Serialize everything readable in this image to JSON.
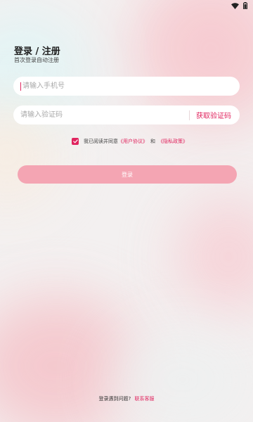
{
  "status_bar": {
    "icons": [
      "wifi-icon",
      "battery-icon"
    ]
  },
  "header": {
    "title": "登录 / 注册",
    "subtitle": "首次登录自动注册"
  },
  "form": {
    "phone_placeholder": "请输入手机号",
    "code_placeholder": "请输入验证码",
    "get_code_label": "获取验证码"
  },
  "agreement": {
    "checked": true,
    "prefix": "我已阅读并同意",
    "user_agreement": "《用户协议》",
    "conjunction": "和",
    "privacy_policy": "《隐私政策》"
  },
  "login_button": "登录",
  "footer": {
    "question": "登录遇到问题?",
    "contact_link": "联系客服"
  },
  "colors": {
    "accent": "#e0245e",
    "button": "#f4a5b3"
  }
}
